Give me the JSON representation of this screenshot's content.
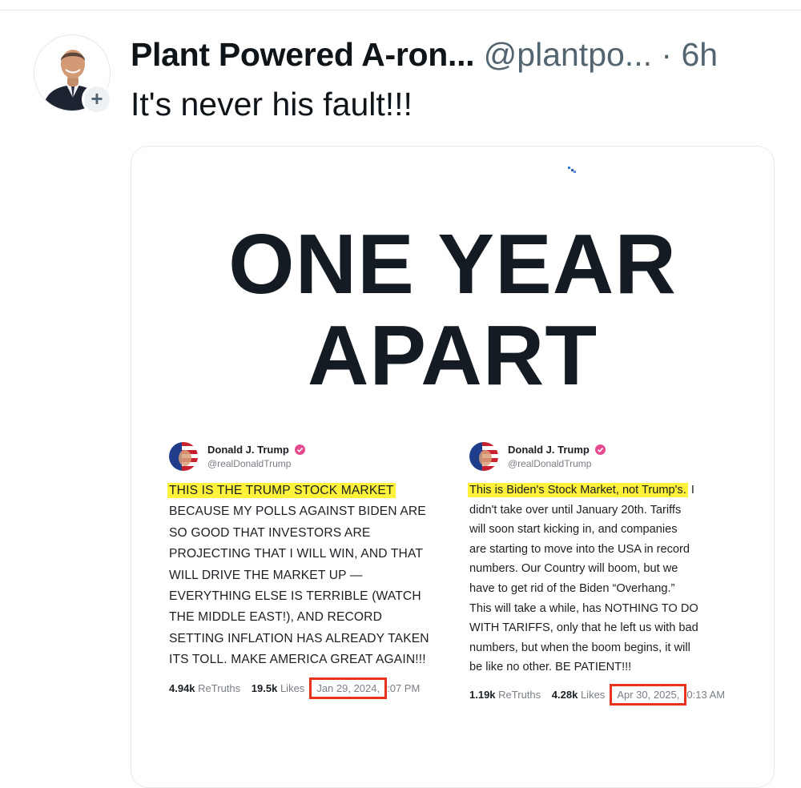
{
  "post": {
    "display_name": "Plant Powered A-ron...",
    "handle": "@plantpo...",
    "separator": "·",
    "time": "6h",
    "text": "It's never his fault!!!",
    "follow_symbol": "+"
  },
  "image": {
    "headline_line1": "ONE YEAR",
    "headline_line2": "APART",
    "left_post": {
      "name": "Donald J. Trump",
      "handle": "@realDonaldTrump",
      "highlight": "THIS IS THE TRUMP STOCK MARKET",
      "lines": [
        "BECAUSE MY POLLS AGAINST BIDEN ARE",
        "SO GOOD THAT INVESTORS ARE",
        "PROJECTING THAT I WILL WIN, AND THAT",
        "WILL DRIVE THE MARKET UP —",
        "EVERYTHING ELSE IS TERRIBLE (WATCH",
        "THE MIDDLE EAST!), AND RECORD",
        "SETTING INFLATION HAS ALREADY TAKEN",
        "ITS TOLL. MAKE AMERICA GREAT AGAIN!!!"
      ],
      "retruths": "4.94k",
      "retruths_label": "ReTruths",
      "likes": "19.5k",
      "likes_label": "Likes",
      "date": "Jan 29, 2024,",
      "time": ":07 PM"
    },
    "right_post": {
      "name": "Donald J. Trump",
      "handle": "@realDonaldTrump",
      "highlight": "This is Biden's Stock Market, not Trump's.",
      "first_line_rest": " I",
      "lines": [
        "didn't take over until January 20th. Tariffs",
        "will soon start kicking in, and companies",
        "are starting to move into the USA in record",
        "numbers. Our Country will boom, but we",
        "have to get rid of the Biden “Overhang.”",
        "This will take a while, has NOTHING TO DO",
        "WITH TARIFFS, only that he left us with bad",
        "numbers, but when the boom begins, it will",
        "be like no other. BE PATIENT!!!"
      ],
      "retruths": "1.19k",
      "retruths_label": "ReTruths",
      "likes": "4.28k",
      "likes_label": "Likes",
      "date": "Apr 30, 2025,",
      "time": "0:13 AM"
    }
  },
  "colors": {
    "highlight": "#fff23a",
    "date_box_border": "#e8331c",
    "verified_badge": "#e64b8f",
    "muted_text": "#536471"
  },
  "icons": {
    "follow": "plus-icon",
    "verified": "verified-badge-icon",
    "profile_left": "flag-avatar-icon",
    "profile_right": "flag-avatar-icon"
  }
}
